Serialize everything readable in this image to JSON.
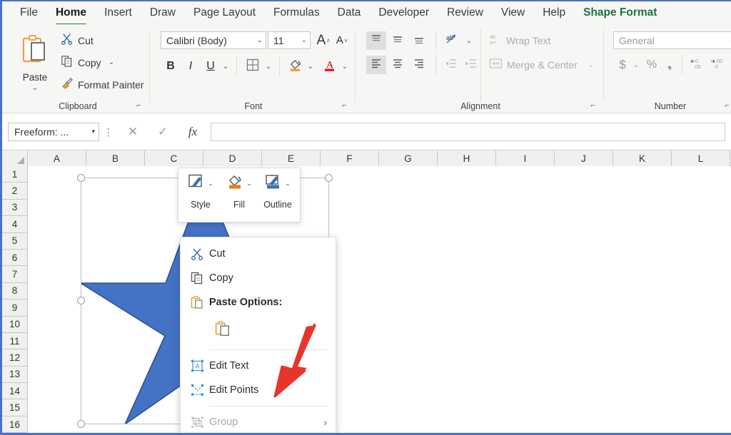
{
  "window": {
    "app": "Microsoft Excel",
    "accent_blue": "#4a6fd4",
    "shape_fill": "#4472C4",
    "shape_outline": "#2f528f",
    "contextual_tab_color": "#1e7145",
    "active_tab_underline": "#217346"
  },
  "ribbon": {
    "tabs": [
      {
        "label": "File",
        "state": "normal"
      },
      {
        "label": "Home",
        "state": "active"
      },
      {
        "label": "Insert",
        "state": "normal"
      },
      {
        "label": "Draw",
        "state": "normal"
      },
      {
        "label": "Page Layout",
        "state": "normal"
      },
      {
        "label": "Formulas",
        "state": "normal"
      },
      {
        "label": "Data",
        "state": "normal"
      },
      {
        "label": "Developer",
        "state": "normal"
      },
      {
        "label": "Review",
        "state": "normal"
      },
      {
        "label": "View",
        "state": "normal"
      },
      {
        "label": "Help",
        "state": "normal"
      },
      {
        "label": "Shape Format",
        "state": "contextual"
      }
    ],
    "groups": {
      "clipboard": {
        "label": "Clipboard",
        "paste": {
          "label": "Paste",
          "icon": "paste-icon",
          "chevron": "⌄"
        },
        "items": [
          {
            "label": "Cut",
            "icon": "scissors-icon",
            "chevron": ""
          },
          {
            "label": "Copy",
            "icon": "copy-icon",
            "chevron": "⌄"
          },
          {
            "label": "Format Painter",
            "icon": "format-painter-icon",
            "chevron": ""
          }
        ]
      },
      "font": {
        "label": "Font",
        "font_name": "Calibri (Body)",
        "font_size": "11",
        "grow_font": "A",
        "shrink_font": "A",
        "bold": "B",
        "italic": "I",
        "underline": "U",
        "borders_icon": "borders-icon",
        "fill_color_icon": "fill-color-icon",
        "font_color_icon": "font-color-icon",
        "fill_color_swatch": "#E8A33D",
        "font_color_swatch": "#E81123"
      },
      "alignment": {
        "label": "Alignment",
        "wrap_text": "Wrap Text",
        "merge_center": "Merge & Center",
        "orientation_icon": "text-orientation-icon",
        "align_top_icon": "align-top-icon",
        "align_middle_icon": "align-middle-icon",
        "align_bottom_icon": "align-bottom-icon",
        "align_left_icon": "align-left-icon",
        "align_center_icon": "align-center-icon",
        "align_right_icon": "align-right-icon",
        "decrease_indent_icon": "decrease-indent-icon",
        "increase_indent_icon": "increase-indent-icon"
      },
      "number": {
        "label": "Number",
        "format": "General",
        "currency": "$",
        "percent": "%",
        "comma": "❟",
        "increase_decimal_icon": "increase-decimal-icon",
        "decrease_decimal_icon": "decrease-decimal-icon"
      }
    }
  },
  "formula_bar": {
    "name_box_value": "Freeform: ...",
    "cancel_icon": "cancel-x-icon",
    "enter_icon": "enter-check-icon",
    "function_icon": "fx-icon",
    "formula_value": "",
    "formula_placeholder": ""
  },
  "sheet": {
    "columns": [
      "A",
      "B",
      "C",
      "D",
      "E",
      "F",
      "G",
      "H",
      "I",
      "J",
      "K",
      "L"
    ],
    "rows": [
      "1",
      "2",
      "3",
      "4",
      "5",
      "6",
      "7",
      "8",
      "9",
      "10",
      "11",
      "12",
      "13",
      "14",
      "15",
      "16"
    ],
    "selected_object": "Freeform shape (5-point star)"
  },
  "mini_toolbar": {
    "items": [
      {
        "label": "Style",
        "icon": "shape-style-icon",
        "chevron": "⌄"
      },
      {
        "label": "Fill",
        "icon": "shape-fill-icon",
        "chevron": "⌄"
      },
      {
        "label": "Outline",
        "icon": "shape-outline-icon",
        "chevron": "⌄"
      }
    ]
  },
  "context_menu": {
    "items": [
      {
        "label": "Cut",
        "icon": "scissors-icon",
        "accel": "t",
        "type": "item",
        "state": "enabled",
        "bold": false,
        "submenu": false
      },
      {
        "label": "Copy",
        "icon": "copy-icon",
        "accel": "C",
        "type": "item",
        "state": "enabled",
        "bold": false,
        "submenu": false
      },
      {
        "label": "Paste Options:",
        "icon": "paste-icon",
        "accel": "",
        "type": "header",
        "state": "enabled",
        "bold": true,
        "submenu": false
      },
      {
        "label": "",
        "icon": "paste-keep-source-icon",
        "accel": "",
        "type": "paste-gallery",
        "state": "enabled",
        "bold": false,
        "submenu": false
      },
      {
        "label": "Edit Text",
        "icon": "edit-text-icon",
        "accel": "x",
        "type": "item",
        "state": "enabled",
        "bold": false,
        "submenu": false
      },
      {
        "label": "Edit Points",
        "icon": "edit-points-icon",
        "accel": "E",
        "type": "item",
        "state": "enabled",
        "bold": false,
        "submenu": false
      },
      {
        "label": "Group",
        "icon": "group-icon",
        "accel": "G",
        "type": "item",
        "state": "disabled",
        "bold": false,
        "submenu": true
      }
    ],
    "submenu_arrow": "›"
  },
  "annotation": {
    "arrow_icon": "red-arrow-icon",
    "arrow_color": "#E8352C",
    "points_to": "Edit Points"
  }
}
